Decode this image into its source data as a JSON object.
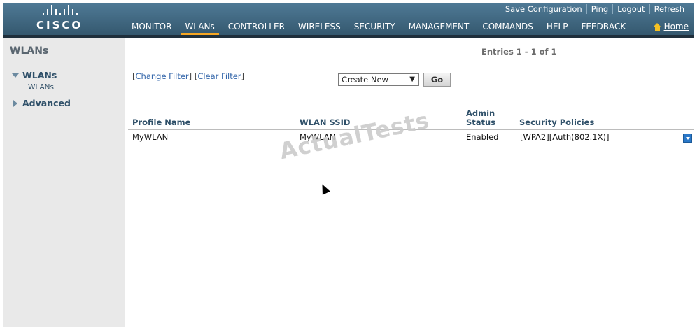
{
  "brand": {
    "logo_text": "CISCO"
  },
  "top_links": {
    "save": "Save Configuration",
    "ping": "Ping",
    "logout": "Logout",
    "refresh": "Refresh"
  },
  "nav": {
    "items": [
      "MONITOR",
      "WLANs",
      "CONTROLLER",
      "WIRELESS",
      "SECURITY",
      "MANAGEMENT",
      "COMMANDS",
      "HELP",
      "FEEDBACK"
    ],
    "active": "WLANs",
    "home": "Home"
  },
  "colors": {
    "header": "#3f6882",
    "accent_tab": "#f5a623",
    "link": "#3366aa",
    "heading": "#2f5069",
    "sidebar_bg": "#e9e9e9"
  },
  "sidebar": {
    "title": "WLANs",
    "group": "WLANs",
    "sub_item": "WLANs",
    "advanced": "Advanced"
  },
  "main": {
    "entries": "Entries 1 - 1 of 1",
    "change_filter": "Change Filter",
    "clear_filter": "Clear Filter",
    "select_value": "Create New",
    "go_label": "Go",
    "columns": [
      "Profile Name",
      "WLAN SSID",
      "Admin",
      "Status",
      "Security Policies"
    ],
    "rows": [
      {
        "profile": "MyWLAN",
        "ssid": "MyWLAN",
        "status": "Enabled",
        "security": "[WPA2][Auth(802.1X)]"
      }
    ]
  },
  "watermark": "ActualTests"
}
